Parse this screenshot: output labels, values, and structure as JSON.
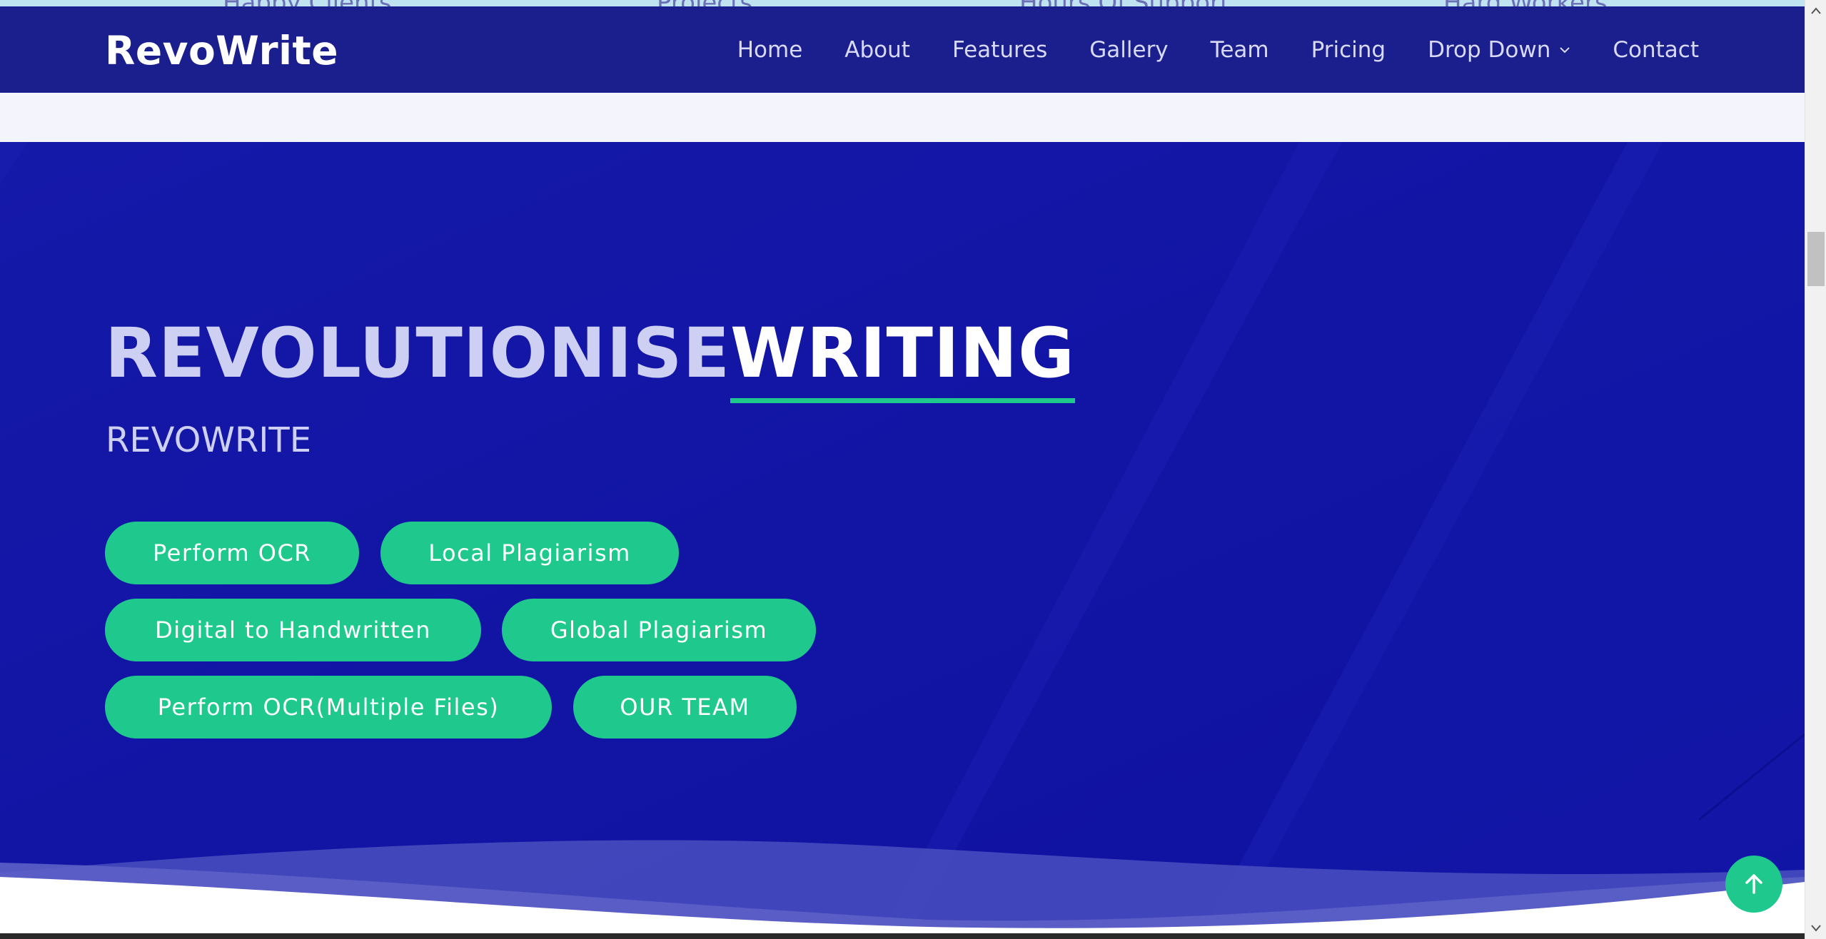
{
  "counters": {
    "labels": [
      "Happy Clients",
      "Projects",
      "Hours Of Support",
      "Hard Workers"
    ]
  },
  "header": {
    "logo": "RevoWrite",
    "nav": [
      {
        "label": "Home"
      },
      {
        "label": "About"
      },
      {
        "label": "Features"
      },
      {
        "label": "Gallery"
      },
      {
        "label": "Team"
      },
      {
        "label": "Pricing"
      },
      {
        "label": "Drop Down",
        "icon": "chevron-down-icon"
      },
      {
        "label": "Contact"
      }
    ]
  },
  "hero": {
    "title_part1": "REVOLUTIONISE",
    "title_part2": "WRITING",
    "subtitle": "REVOWRITE",
    "buttons": [
      "Perform OCR",
      "Local Plagiarism",
      "Digital to Handwritten",
      "Global Plagiarism",
      "Perform OCR(Multiple Files)",
      "OUR TEAM"
    ]
  },
  "scroll_top": {
    "icon": "arrow-up-icon"
  },
  "colors": {
    "header_bg": "#1b1f8e",
    "hero_bg": "#1112a2",
    "accent": "#1fc98e",
    "light_strip": "#f4f4fd"
  }
}
